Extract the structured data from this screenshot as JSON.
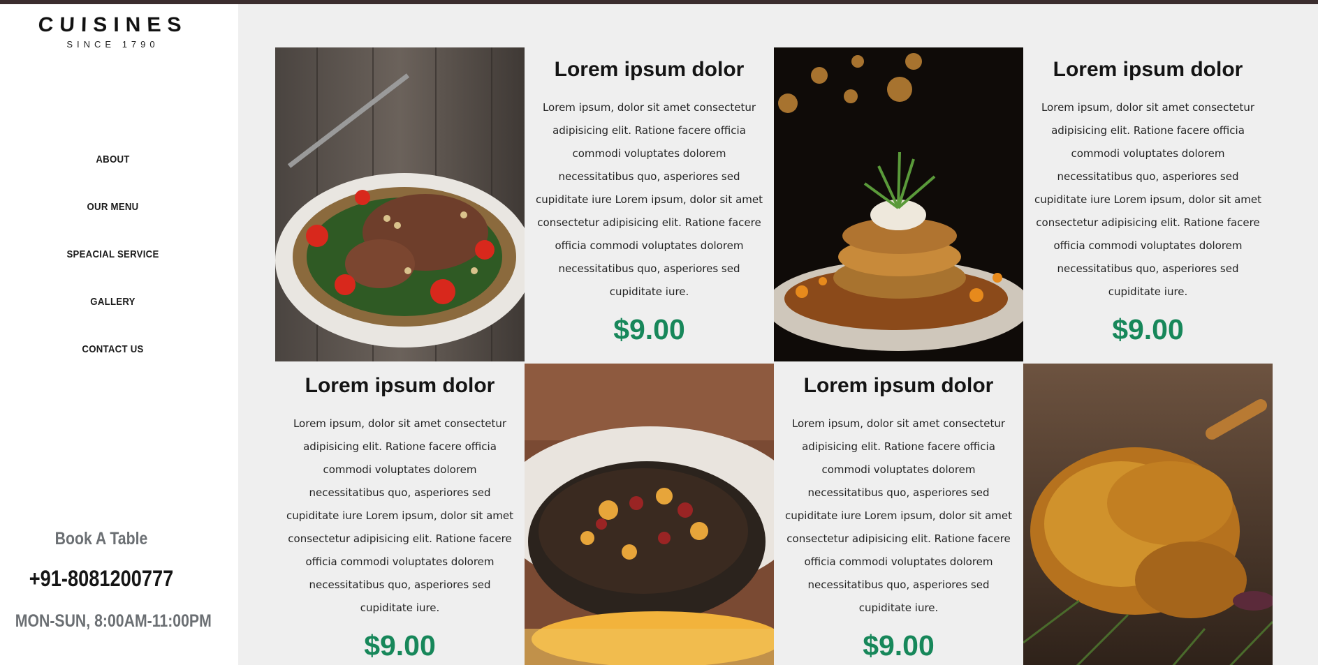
{
  "brand": {
    "title": "CUISINES",
    "subtitle": "SINCE 1790"
  },
  "nav": {
    "items": [
      {
        "label": "ABOUT"
      },
      {
        "label": "OUR MENU"
      },
      {
        "label": "SPEACIAL SERVICE"
      },
      {
        "label": "GALLERY"
      },
      {
        "label": "CONTACT US"
      }
    ]
  },
  "booking": {
    "title": "Book A Table",
    "phone": "+91-8081200777",
    "hours": "MON-SUN, 8:00AM-11:00PM"
  },
  "cards": [
    {
      "title": "Lorem ipsum dolor",
      "description": "Lorem ipsum, dolor sit amet consectetur adipisicing elit. Ratione facere officia commodi voluptates dolorem necessitatibus quo, asperiores sed cupiditate iure Lorem ipsum, dolor sit amet consectetur adipisicing elit. Ratione facere officia commodi voluptates dolorem necessitatibus quo, asperiores sed cupiditate iure.",
      "price": "$9.00"
    },
    {
      "title": "Lorem ipsum dolor",
      "description": "Lorem ipsum, dolor sit amet consectetur adipisicing elit. Ratione facere officia commodi voluptates dolorem necessitatibus quo, asperiores sed cupiditate iure Lorem ipsum, dolor sit amet consectetur adipisicing elit. Ratione facere officia commodi voluptates dolorem necessitatibus quo, asperiores sed cupiditate iure.",
      "price": "$9.00"
    },
    {
      "title": "Lorem ipsum dolor",
      "description": "Lorem ipsum, dolor sit amet consectetur adipisicing elit. Ratione facere officia commodi voluptates dolorem necessitatibus quo, asperiores sed cupiditate iure Lorem ipsum, dolor sit amet consectetur adipisicing elit. Ratione facere officia commodi voluptates dolorem necessitatibus quo, asperiores sed cupiditate iure.",
      "price": "$9.00"
    },
    {
      "title": "Lorem ipsum dolor",
      "description": "Lorem ipsum, dolor sit amet consectetur adipisicing elit. Ratione facere officia commodi voluptates dolorem necessitatibus quo, asperiores sed cupiditate iure Lorem ipsum, dolor sit amet consectetur adipisicing elit. Ratione facere officia commodi voluptates dolorem necessitatibus quo, asperiores sed cupiditate iure.",
      "price": "$9.00"
    }
  ],
  "colors": {
    "price": "#17875a",
    "topbar": "#3b2d2e",
    "sidebar_muted": "#6b6f73"
  }
}
